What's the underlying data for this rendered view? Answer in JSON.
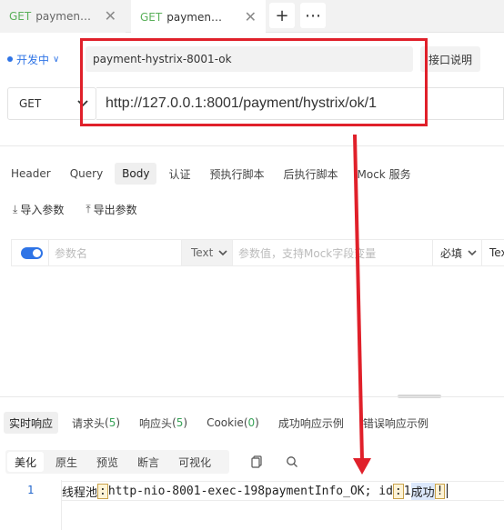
{
  "tabs": [
    {
      "method": "GET",
      "name": "payment..."
    },
    {
      "method": "GET",
      "name": "payment..."
    }
  ],
  "tab_actions": {
    "add": "+",
    "more": "⋯"
  },
  "env": {
    "label": "开发中"
  },
  "request": {
    "name": "payment-hystrix-8001-ok",
    "doc_button": "接口说明",
    "method": "GET",
    "url": "http://127.0.0.1:8001/payment/hystrix/ok/1"
  },
  "request_tabs": [
    "Header",
    "Query",
    "Body",
    "认证",
    "预执行脚本",
    "后执行脚本",
    "Mock 服务"
  ],
  "request_tab_active": "Body",
  "param_actions": {
    "import": "导入参数",
    "export": "导出参数"
  },
  "param_row": {
    "name_placeholder": "参数名",
    "type": "Text",
    "value_placeholder": "参数值，支持Mock字段变量",
    "required": "必填",
    "type2": "Tex"
  },
  "response_tabs": [
    {
      "label": "实时响应",
      "count": ""
    },
    {
      "label": "请求头",
      "count": "5"
    },
    {
      "label": "响应头",
      "count": "5"
    },
    {
      "label": "Cookie",
      "count": "0"
    },
    {
      "label": "成功响应示例",
      "count": ""
    },
    {
      "label": "错误响应示例",
      "count": ""
    }
  ],
  "view_modes": [
    "美化",
    "原生",
    "预览",
    "断言",
    "可视化"
  ],
  "response_body": {
    "line_number": "1",
    "prefix": "线程池",
    "colon1": ":",
    "thread": "http-nio-8001-exec-198paymentInfo_OK; id",
    "colon2": ":",
    "id_value": "1",
    "success": " 成功",
    "excl": "!"
  },
  "colors": {
    "accent": "#2f74e6",
    "annotation_red": "#e0202a",
    "method_green": "#5ab05a",
    "count_green": "#3aa35a"
  }
}
